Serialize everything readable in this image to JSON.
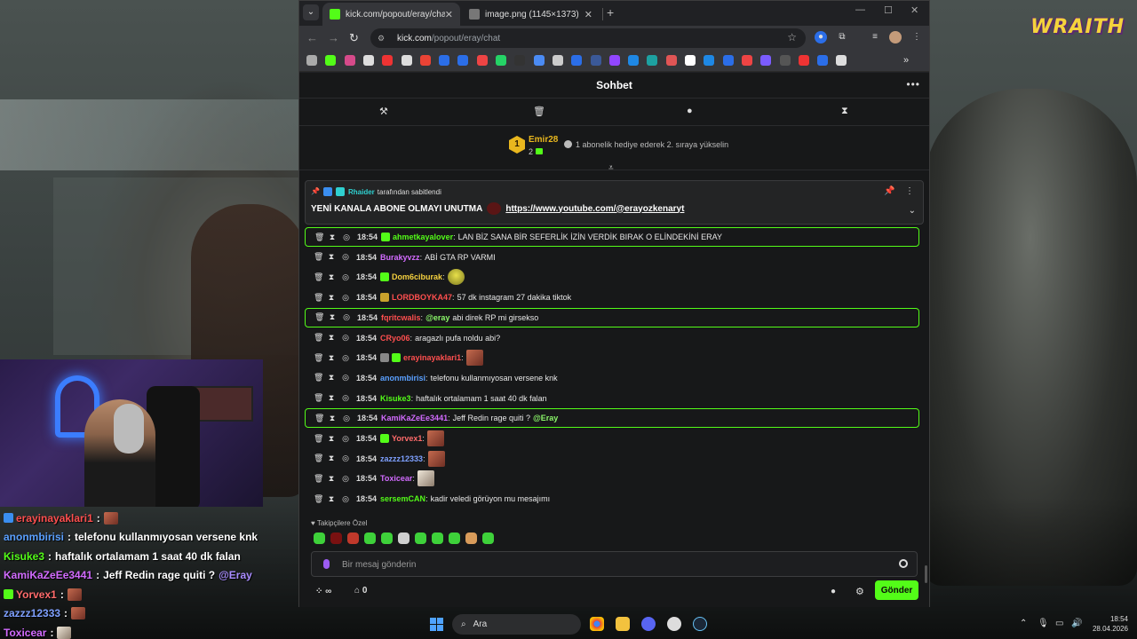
{
  "overlay": {
    "brand": "WRAITH",
    "chat": [
      {
        "user": "erayinayaklari1",
        "color": "#ff4f4f",
        "msg": "",
        "emote": "red"
      },
      {
        "user": "anonmbirisi",
        "color": "#5aa0ff",
        "msg": "telefonu kullanmıyosan versene knk"
      },
      {
        "user": "Kisuke3",
        "color": "#53fc18",
        "msg": "haftalık ortalamam 1 saat 40 dk falan"
      },
      {
        "user": "KamiKaZeEe3441",
        "color": "#d26bff",
        "msg": "Jeff Redin rage quiti ?",
        "mention": "@Eray"
      },
      {
        "user": "Yorvex1",
        "color": "#ff6b6b",
        "msg": "",
        "emote": "red"
      },
      {
        "user": "zazzz12333",
        "color": "#7ea0ff",
        "msg": "",
        "emote": "red"
      },
      {
        "user": "Toxicear",
        "color": "#d26bff",
        "msg": "",
        "emote": "cat"
      }
    ]
  },
  "browser": {
    "tabs": [
      {
        "title": "kick.com/popout/eray/chat",
        "active": true,
        "favicon_color": "#53fc18"
      },
      {
        "title": "image.png (1145×1373)",
        "active": false,
        "favicon_color": "#777777"
      }
    ],
    "url_host": "kick.com",
    "url_path": "/popout/eray/chat"
  },
  "chat": {
    "title": "Sohbet",
    "leaderboard": {
      "rank": "1",
      "name": "Emir28",
      "count": "2",
      "hint": "1 abonelik hediye ederek 2. sıraya yükselin"
    },
    "pinned": {
      "pinned_by_user": "Rhaider",
      "pinned_by_text": "tarafından sabitlendi",
      "message": "YENİ KANALA ABONE OLMAYI UNUTMA",
      "link": "https://www.youtube.com/@erayozkenaryt"
    },
    "messages": [
      {
        "time": "18:54",
        "user": "ahmetkayalover",
        "color": "#53fc18",
        "text": "LAN BİZ SANA BİR SEFERLİK İZİN VERDİK BIRAK O ELİNDEKİNİ ERAY",
        "highlight": true,
        "badge": "green"
      },
      {
        "time": "18:54",
        "user": "Burakyvzz",
        "color": "#d26bff",
        "text": "ABİ GTA RP VARMI"
      },
      {
        "time": "18:54",
        "user": "Dom6ciburak",
        "color": "#f4d03f",
        "text": "",
        "badge": "green",
        "emote": "face"
      },
      {
        "time": "18:54",
        "user": "LORDBOYKA47",
        "color": "#ff4f4f",
        "text": "57 dk instagram 27 dakika tiktok",
        "badge": "gold"
      },
      {
        "time": "18:54",
        "user": "fqritcwalis",
        "color": "#ff4f4f",
        "text": "abi direk RP mi girsekso",
        "mention": "@eray",
        "highlight": true
      },
      {
        "time": "18:54",
        "user": "CRyo06",
        "color": "#ff4f4f",
        "text": "aragazlı pufa noldu abi?"
      },
      {
        "time": "18:54",
        "user": "erayinayaklari1",
        "color": "#ff4f4f",
        "text": "",
        "badge": "grey",
        "badge2": "green",
        "emote": "red"
      },
      {
        "time": "18:54",
        "user": "anonmbirisi",
        "color": "#5aa0ff",
        "text": "telefonu kullanmıyosan versene knk"
      },
      {
        "time": "18:54",
        "user": "Kisuke3",
        "color": "#53fc18",
        "text": "haftalık ortalamam 1 saat 40 dk falan"
      },
      {
        "time": "18:54",
        "user": "KamiKaZeEe3441",
        "color": "#d26bff",
        "text": "Jeff Redin rage quiti ?",
        "mention_after": "@Eray",
        "highlight": true
      },
      {
        "time": "18:54",
        "user": "Yorvex1",
        "color": "#ff6b6b",
        "text": "",
        "badge": "green",
        "emote": "red"
      },
      {
        "time": "18:54",
        "user": "zazzz12333",
        "color": "#7ea0ff",
        "text": "",
        "emote": "red"
      },
      {
        "time": "18:54",
        "user": "Toxicear",
        "color": "#d26bff",
        "text": "",
        "emote": "cat"
      },
      {
        "time": "18:54",
        "user": "sersemCAN",
        "color": "#53fc18",
        "text": "kadir veledi görüyon mu mesajımı"
      }
    ],
    "followers_label": "Takipçilere Özel",
    "input_placeholder": "Bir mesaj gönderin",
    "store_count": "0",
    "send_label": "Gönder"
  },
  "taskbar": {
    "search_label": "Ara",
    "time": "18:54",
    "date": "28.04.2026"
  }
}
